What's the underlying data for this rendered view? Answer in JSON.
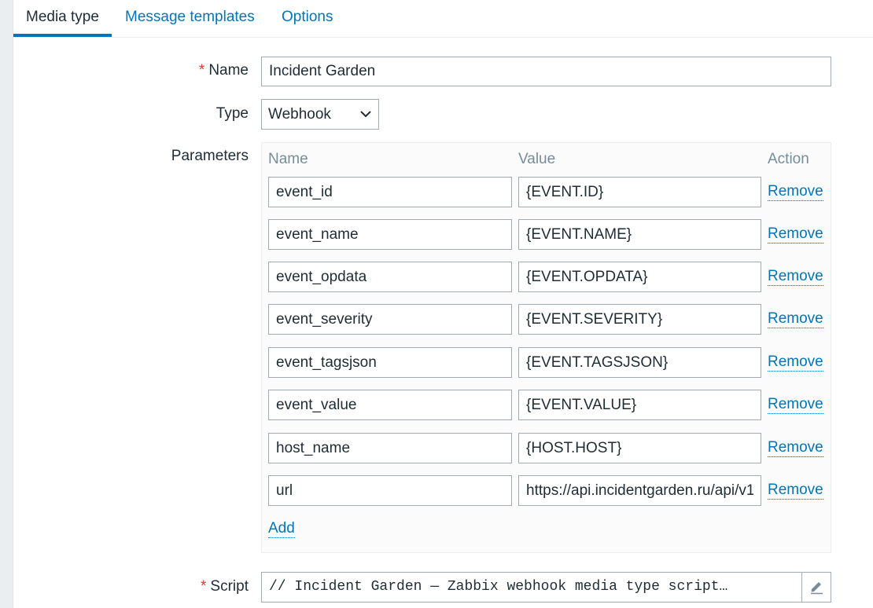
{
  "tabs": [
    {
      "label": "Media type",
      "active": true
    },
    {
      "label": "Message templates",
      "active": false
    },
    {
      "label": "Options",
      "active": false
    }
  ],
  "form": {
    "name": {
      "label": "Name",
      "required": true,
      "value": "Incident Garden"
    },
    "type": {
      "label": "Type",
      "value": "Webhook"
    },
    "parameters": {
      "label": "Parameters",
      "columns": {
        "name": "Name",
        "value": "Value",
        "action": "Action"
      },
      "rows": [
        {
          "name": "event_id",
          "value": "{EVENT.ID}",
          "action": "Remove"
        },
        {
          "name": "event_name",
          "value": "{EVENT.NAME}",
          "action": "Remove"
        },
        {
          "name": "event_opdata",
          "value": "{EVENT.OPDATA}",
          "action": "Remove"
        },
        {
          "name": "event_severity",
          "value": "{EVENT.SEVERITY}",
          "action": "Remove"
        },
        {
          "name": "event_tagsjson",
          "value": "{EVENT.TAGSJSON}",
          "action": "Remove"
        },
        {
          "name": "event_value",
          "value": "{EVENT.VALUE}",
          "action": "Remove"
        },
        {
          "name": "host_name",
          "value": "{HOST.HOST}",
          "action": "Remove"
        },
        {
          "name": "url",
          "value": "https://api.incidentgarden.ru/api/v1",
          "action": "Remove"
        }
      ],
      "add_label": "Add"
    },
    "script": {
      "label": "Script",
      "required": true,
      "value": "// Incident Garden — Zabbix webhook media type script…"
    }
  },
  "required_mark": "*",
  "icons": {
    "select_arrow": "chevron-down-icon",
    "script_edit": "pencil-icon"
  },
  "colors": {
    "accent": "#0275b8",
    "required": "#e33734",
    "muted": "#768d99",
    "border": "#a3aab0"
  }
}
